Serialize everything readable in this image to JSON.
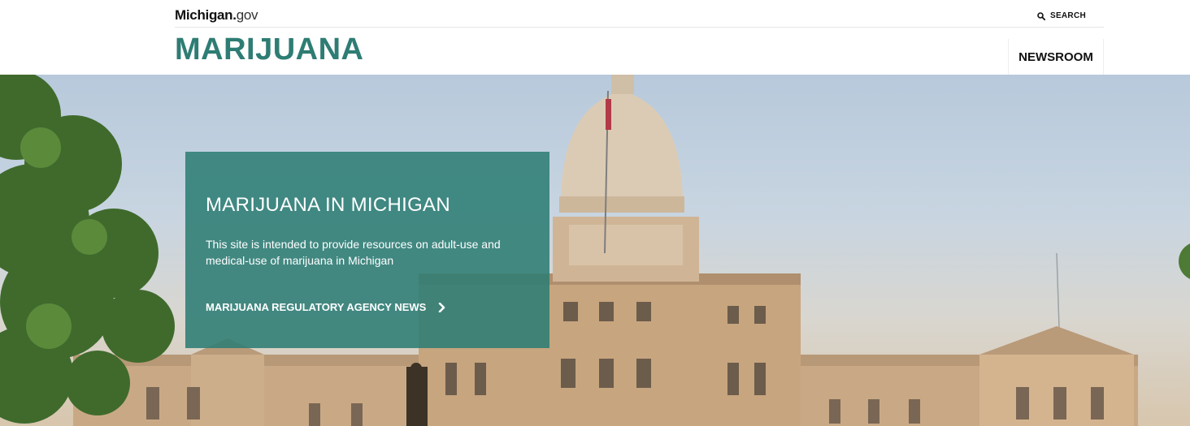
{
  "header": {
    "logo_bold": "Michigan.",
    "logo_light": "gov",
    "search_label": "SEARCH",
    "site_title": "MARIJUANA",
    "nav": [
      {
        "label": "NEWSROOM"
      }
    ]
  },
  "hero": {
    "title": "MARIJUANA IN MICHIGAN",
    "description": "This site is intended to provide resources on adult-use and medical-use of marijuana in Michigan",
    "link_label": "MARIJUANA REGULATORY AGENCY NEWS"
  },
  "colors": {
    "brand_teal": "#2e7d74",
    "promo_bg": "#2e7d74",
    "text_dark": "#111111"
  },
  "icons": {
    "search": "search-icon",
    "chevron": "chevron-right-icon"
  }
}
